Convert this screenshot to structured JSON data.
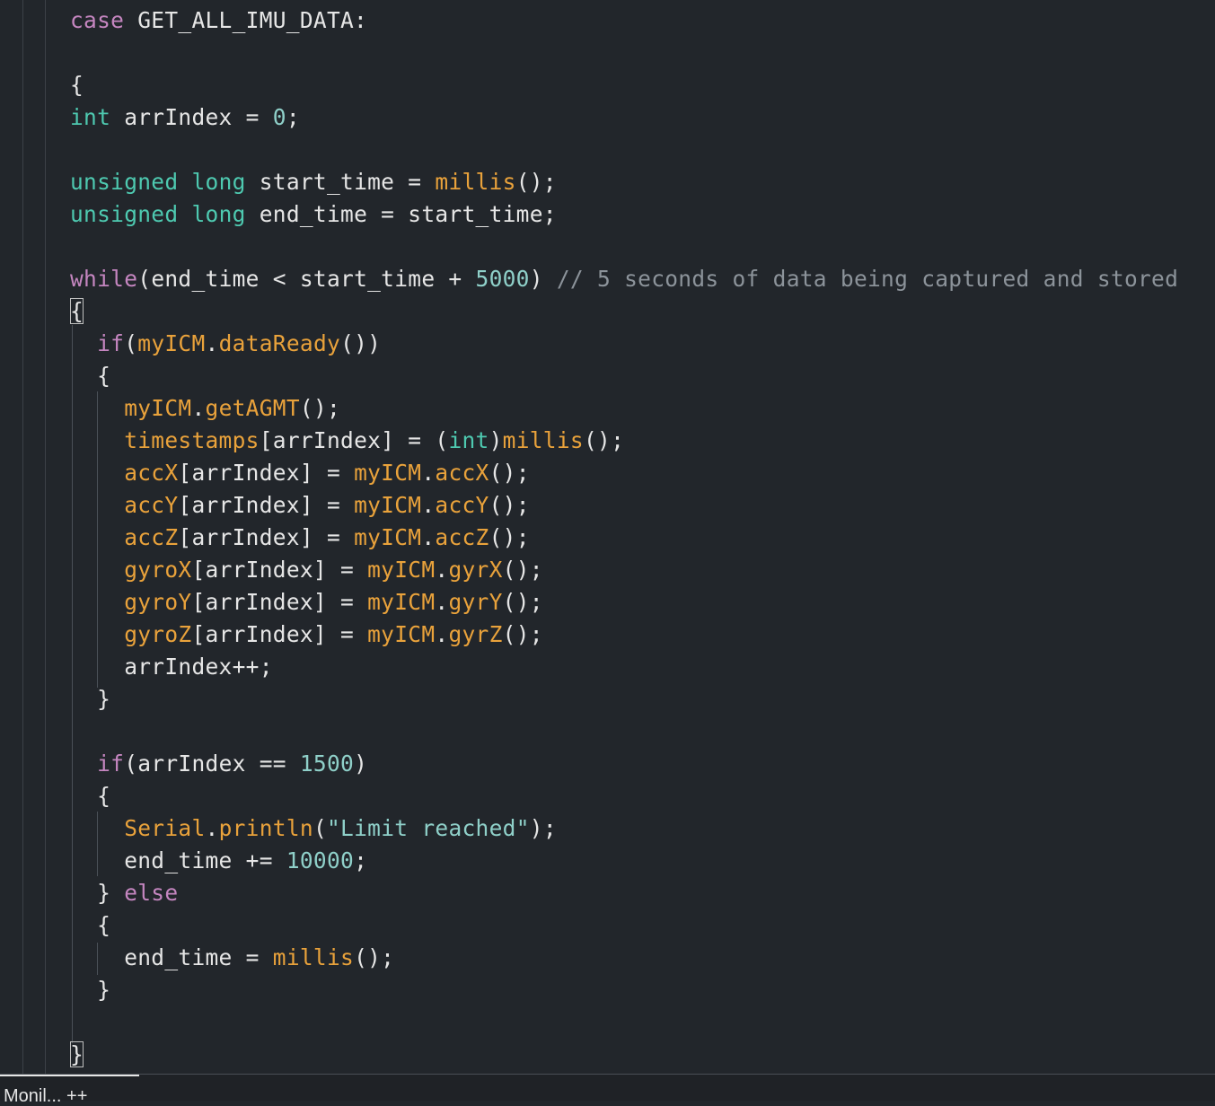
{
  "editor": {
    "lines": [
      [
        {
          "t": "kw",
          "v": "case"
        },
        {
          "t": "pl",
          "v": " GET_ALL_IMU_DATA:"
        }
      ],
      [],
      [
        {
          "t": "pl",
          "v": "{"
        }
      ],
      [
        {
          "t": "ty",
          "v": "int"
        },
        {
          "t": "pl",
          "v": " arrIndex = "
        },
        {
          "t": "num",
          "v": "0"
        },
        {
          "t": "pl",
          "v": ";"
        }
      ],
      [],
      [
        {
          "t": "ty",
          "v": "unsigned"
        },
        {
          "t": "pl",
          "v": " "
        },
        {
          "t": "ty",
          "v": "long"
        },
        {
          "t": "pl",
          "v": " start_time = "
        },
        {
          "t": "fn",
          "v": "millis"
        },
        {
          "t": "pl",
          "v": "();"
        }
      ],
      [
        {
          "t": "ty",
          "v": "unsigned"
        },
        {
          "t": "pl",
          "v": " "
        },
        {
          "t": "ty",
          "v": "long"
        },
        {
          "t": "pl",
          "v": " end_time = start_time;"
        }
      ],
      [],
      [
        {
          "t": "kw",
          "v": "while"
        },
        {
          "t": "pl",
          "v": "(end_time < start_time + "
        },
        {
          "t": "num",
          "v": "5000"
        },
        {
          "t": "pl",
          "v": ") "
        },
        {
          "t": "cm",
          "v": "// 5 seconds of data being captured and stored"
        }
      ],
      [
        {
          "t": "pl",
          "v": "{",
          "box": true
        }
      ],
      [
        {
          "t": "pl",
          "v": "  "
        },
        {
          "t": "kw",
          "v": "if"
        },
        {
          "t": "pl",
          "v": "("
        },
        {
          "t": "fn",
          "v": "myICM"
        },
        {
          "t": "pl",
          "v": "."
        },
        {
          "t": "fn",
          "v": "dataReady"
        },
        {
          "t": "pl",
          "v": "())"
        }
      ],
      [
        {
          "t": "pl",
          "v": "  {"
        }
      ],
      [
        {
          "t": "pl",
          "v": "    "
        },
        {
          "t": "fn",
          "v": "myICM"
        },
        {
          "t": "pl",
          "v": "."
        },
        {
          "t": "fn",
          "v": "getAGMT"
        },
        {
          "t": "pl",
          "v": "();"
        }
      ],
      [
        {
          "t": "pl",
          "v": "    "
        },
        {
          "t": "fn",
          "v": "timestamps"
        },
        {
          "t": "pl",
          "v": "[arrIndex] = ("
        },
        {
          "t": "ty",
          "v": "int"
        },
        {
          "t": "pl",
          "v": ")"
        },
        {
          "t": "fn",
          "v": "millis"
        },
        {
          "t": "pl",
          "v": "();"
        }
      ],
      [
        {
          "t": "pl",
          "v": "    "
        },
        {
          "t": "fn",
          "v": "accX"
        },
        {
          "t": "pl",
          "v": "[arrIndex] = "
        },
        {
          "t": "fn",
          "v": "myICM"
        },
        {
          "t": "pl",
          "v": "."
        },
        {
          "t": "fn",
          "v": "accX"
        },
        {
          "t": "pl",
          "v": "();"
        }
      ],
      [
        {
          "t": "pl",
          "v": "    "
        },
        {
          "t": "fn",
          "v": "accY"
        },
        {
          "t": "pl",
          "v": "[arrIndex] = "
        },
        {
          "t": "fn",
          "v": "myICM"
        },
        {
          "t": "pl",
          "v": "."
        },
        {
          "t": "fn",
          "v": "accY"
        },
        {
          "t": "pl",
          "v": "();"
        }
      ],
      [
        {
          "t": "pl",
          "v": "    "
        },
        {
          "t": "fn",
          "v": "accZ"
        },
        {
          "t": "pl",
          "v": "[arrIndex] = "
        },
        {
          "t": "fn",
          "v": "myICM"
        },
        {
          "t": "pl",
          "v": "."
        },
        {
          "t": "fn",
          "v": "accZ"
        },
        {
          "t": "pl",
          "v": "();"
        }
      ],
      [
        {
          "t": "pl",
          "v": "    "
        },
        {
          "t": "fn",
          "v": "gyroX"
        },
        {
          "t": "pl",
          "v": "[arrIndex] = "
        },
        {
          "t": "fn",
          "v": "myICM"
        },
        {
          "t": "pl",
          "v": "."
        },
        {
          "t": "fn",
          "v": "gyrX"
        },
        {
          "t": "pl",
          "v": "();"
        }
      ],
      [
        {
          "t": "pl",
          "v": "    "
        },
        {
          "t": "fn",
          "v": "gyroY"
        },
        {
          "t": "pl",
          "v": "[arrIndex] = "
        },
        {
          "t": "fn",
          "v": "myICM"
        },
        {
          "t": "pl",
          "v": "."
        },
        {
          "t": "fn",
          "v": "gyrY"
        },
        {
          "t": "pl",
          "v": "();"
        }
      ],
      [
        {
          "t": "pl",
          "v": "    "
        },
        {
          "t": "fn",
          "v": "gyroZ"
        },
        {
          "t": "pl",
          "v": "[arrIndex] = "
        },
        {
          "t": "fn",
          "v": "myICM"
        },
        {
          "t": "pl",
          "v": "."
        },
        {
          "t": "fn",
          "v": "gyrZ"
        },
        {
          "t": "pl",
          "v": "();"
        }
      ],
      [
        {
          "t": "pl",
          "v": "    arrIndex++;"
        }
      ],
      [
        {
          "t": "pl",
          "v": "  }"
        }
      ],
      [],
      [
        {
          "t": "pl",
          "v": "  "
        },
        {
          "t": "kw",
          "v": "if"
        },
        {
          "t": "pl",
          "v": "(arrIndex == "
        },
        {
          "t": "num",
          "v": "1500"
        },
        {
          "t": "pl",
          "v": ")"
        }
      ],
      [
        {
          "t": "pl",
          "v": "  {"
        }
      ],
      [
        {
          "t": "pl",
          "v": "    "
        },
        {
          "t": "fn",
          "v": "Serial"
        },
        {
          "t": "pl",
          "v": "."
        },
        {
          "t": "fn",
          "v": "println"
        },
        {
          "t": "pl",
          "v": "("
        },
        {
          "t": "str",
          "v": "\"Limit reached\""
        },
        {
          "t": "pl",
          "v": ");"
        }
      ],
      [
        {
          "t": "pl",
          "v": "    end_time += "
        },
        {
          "t": "num",
          "v": "10000"
        },
        {
          "t": "pl",
          "v": ";"
        }
      ],
      [
        {
          "t": "pl",
          "v": "  } "
        },
        {
          "t": "kw",
          "v": "else"
        }
      ],
      [
        {
          "t": "pl",
          "v": "  {"
        }
      ],
      [
        {
          "t": "pl",
          "v": "    end_time = "
        },
        {
          "t": "fn",
          "v": "millis"
        },
        {
          "t": "pl",
          "v": "();"
        }
      ],
      [
        {
          "t": "pl",
          "v": "  }"
        }
      ],
      [],
      [
        {
          "t": "pl",
          "v": "}",
          "box": true
        }
      ]
    ]
  },
  "status": {
    "partial_text": "l Monil... ++"
  },
  "colors": {
    "background": "#22262b",
    "keyword": "#c586c0",
    "type": "#4ec9b0",
    "function": "#e9a23b",
    "number": "#8fd0c9",
    "comment": "#8c939a"
  }
}
